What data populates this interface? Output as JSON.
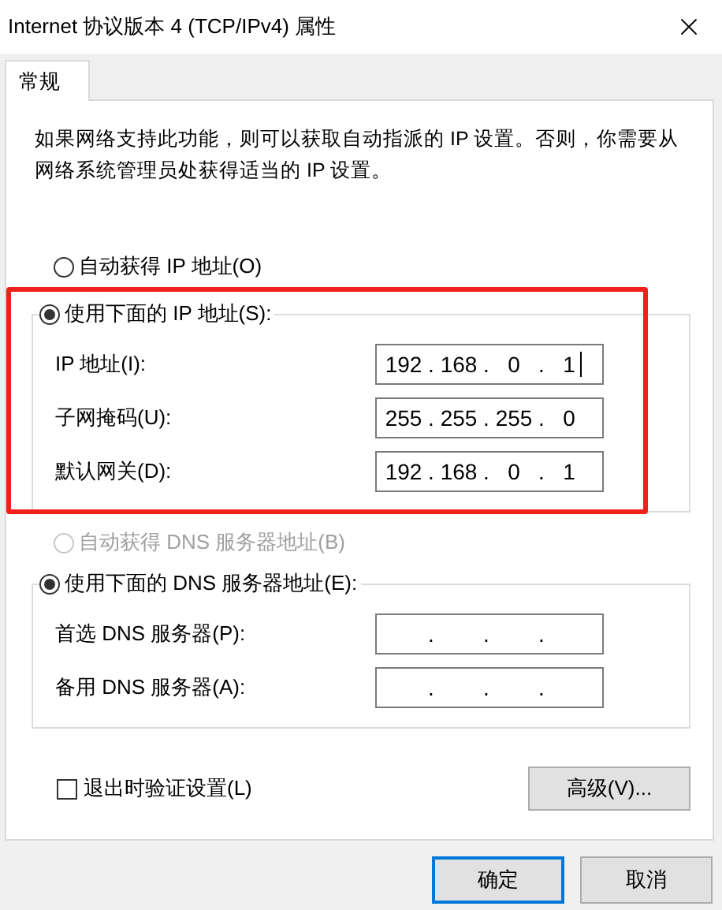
{
  "window": {
    "title": "Internet 协议版本 4 (TCP/IPv4) 属性"
  },
  "tabs": [
    {
      "label": "常规",
      "selected": true
    }
  ],
  "description": "如果网络支持此功能，则可以获取自动指派的 IP 设置。否则，你需要从网络系统管理员处获得适当的 IP 设置。",
  "ip_auto": {
    "label": "自动获得 IP 地址(O)",
    "selected": false,
    "disabled": false
  },
  "ip_group": {
    "label": "使用下面的 IP 地址(S):",
    "selected": true,
    "highlighted": true,
    "fields": [
      {
        "label": "IP 地址(I):",
        "octets": [
          "192",
          "168",
          "0",
          "1"
        ],
        "dots": [
          ".",
          ".",
          "."
        ],
        "focused": true
      },
      {
        "label": "子网掩码(U):",
        "octets": [
          "255",
          "255",
          "255",
          "0"
        ],
        "dots": [
          ".",
          ".",
          "."
        ],
        "focused": false
      },
      {
        "label": "默认网关(D):",
        "octets": [
          "192",
          "168",
          "0",
          "1"
        ],
        "dots": [
          ".",
          ".",
          "."
        ],
        "focused": false
      }
    ]
  },
  "dns_auto": {
    "label": "自动获得 DNS 服务器地址(B)",
    "selected": false,
    "disabled": true
  },
  "dns_group": {
    "label": "使用下面的 DNS 服务器地址(E):",
    "selected": true,
    "fields": [
      {
        "label": "首选 DNS 服务器(P):",
        "dots": [
          ".",
          ".",
          "."
        ],
        "focused": false
      },
      {
        "label": "备用 DNS 服务器(A):",
        "dots": [
          ".",
          ".",
          "."
        ],
        "focused": false
      }
    ]
  },
  "validate": {
    "label": "退出时验证设置(L)",
    "checked": false
  },
  "advanced_button": "高级(V)...",
  "buttons": [
    {
      "label": "确定",
      "default": true
    },
    {
      "label": "取消",
      "default": false
    }
  ]
}
